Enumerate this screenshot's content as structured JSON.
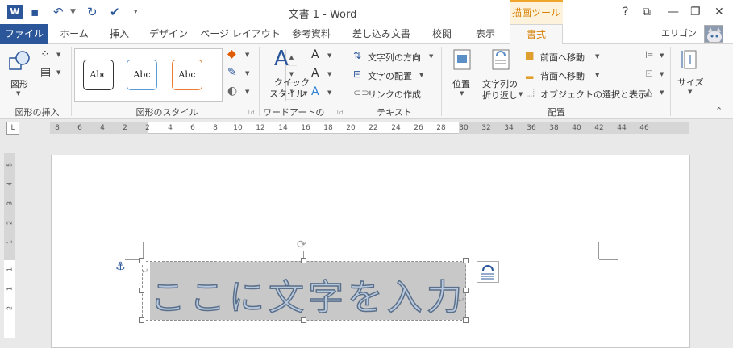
{
  "titlebar": {
    "app_icon": "W",
    "document_title": "文書 1 - Word",
    "context_group": "描画ツール",
    "qat_icons": [
      "word-app-icon",
      "save-icon",
      "undo-icon",
      "redo-icon",
      "spellcheck-icon",
      "customize-qat-icon"
    ],
    "window_buttons": {
      "help": "?",
      "ribbon_options": "⧉",
      "minimize": "—",
      "restore": "❐",
      "close": "✕"
    }
  },
  "tabs": {
    "file": "ファイル",
    "items": [
      "ホーム",
      "挿入",
      "デザイン",
      "ページ レイアウト",
      "参考資料",
      "差し込み文書",
      "校閲",
      "表示"
    ],
    "active": "書式",
    "user": "エリゴン"
  },
  "ribbon": {
    "groups": {
      "insert_shapes": "図形の挿入",
      "shape_styles": "図形のスタイル",
      "wordart_styles": "ワードアートのス...",
      "text": "テキスト",
      "arrange": "配置"
    },
    "insert_shapes": {
      "shape_label": "図形"
    },
    "gallery": {
      "items": [
        "Abc",
        "Abc",
        "Abc"
      ]
    },
    "wordart": {
      "quick_style_line1": "クイック",
      "quick_style_line2": "スタイル"
    },
    "text": {
      "direction": "文字列の方向",
      "align": "文字の配置",
      "link": "リンクの作成"
    },
    "arrange": {
      "position": "位置",
      "wrap_line1": "文字列の",
      "wrap_line2": "折り返し",
      "bring_forward": "前面へ移動",
      "send_backward": "背面へ移動",
      "selection_pane": "オブジェクトの選択と表示"
    },
    "size": {
      "label": "サイズ"
    }
  },
  "ruler": {
    "corner": "L",
    "ticks": [
      "8",
      "6",
      "4",
      "2",
      "2",
      "4",
      "6",
      "8",
      "10",
      "12",
      "14",
      "16",
      "18",
      "20",
      "22",
      "24",
      "26",
      "28",
      "30",
      "32",
      "34",
      "36",
      "38",
      "40",
      "42",
      "44",
      "46"
    ],
    "vticks": [
      "5",
      "4",
      "3",
      "2",
      "1",
      "1",
      "1",
      "2"
    ]
  },
  "document": {
    "wordart_text": "ここに文字を入力"
  },
  "colors": {
    "word_blue": "#2b579a",
    "context_orange": "#d77f00",
    "context_bg": "#fdf3dc",
    "wordart_fill": "#b8c8dc",
    "wordart_outline": "#5a6f8a"
  }
}
